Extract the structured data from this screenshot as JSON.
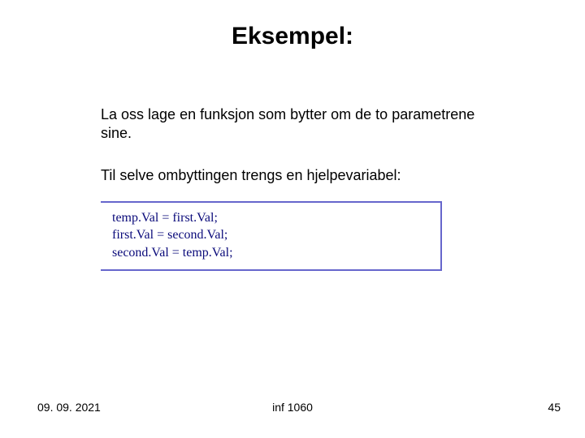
{
  "title": "Eksempel:",
  "para1": "La oss lage en funksjon som bytter om de to parametrene sine.",
  "para2": "Til selve ombyttingen trengs en hjelpevariabel:",
  "code": {
    "line1": "temp.Val = first.Val;",
    "line2": "first.Val = second.Val;",
    "line3": "second.Val = temp.Val;"
  },
  "footer": {
    "date": "09. 09. 2021",
    "center": "inf 1060",
    "page": "45"
  }
}
